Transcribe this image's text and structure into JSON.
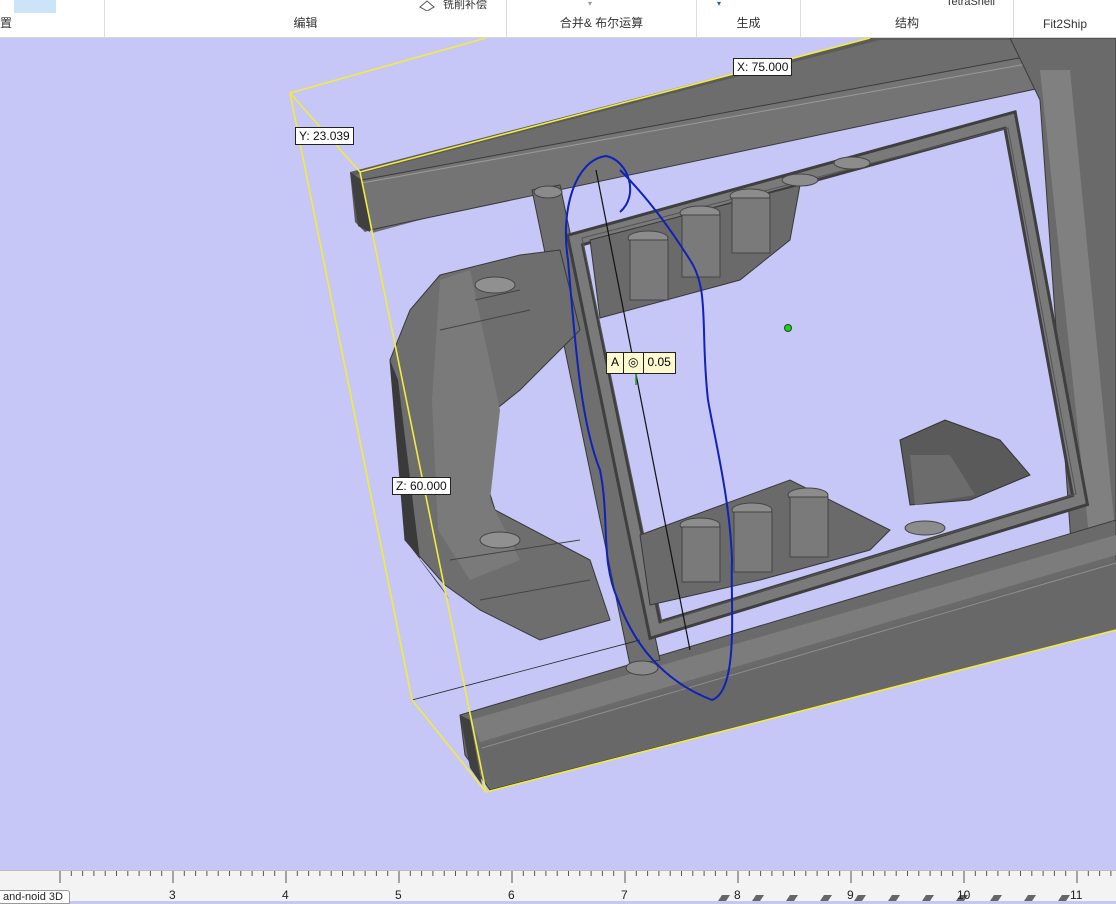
{
  "ribbon": {
    "groups": [
      {
        "label": "置"
      },
      {
        "label": "编辑"
      },
      {
        "label": "合并& 布尔运算"
      },
      {
        "label": "生成"
      },
      {
        "label": "结构"
      },
      {
        "label": "Fit2Ship"
      }
    ],
    "cut_labels": [
      "铣削补偿",
      "TetraShell"
    ]
  },
  "viewport": {
    "background": "#c6c6f7",
    "dimensions": {
      "x": "X: 75.000",
      "y": "Y: 23.039",
      "z": "Z: 60.000"
    },
    "gdt": {
      "datum": "A",
      "symbol": "◎",
      "tolerance": "0.05"
    }
  },
  "ruler": {
    "numbers": [
      "3",
      "4",
      "5",
      "6",
      "7",
      "8",
      "9",
      "10",
      "11"
    ]
  },
  "status_tab": "and-noid 3D"
}
